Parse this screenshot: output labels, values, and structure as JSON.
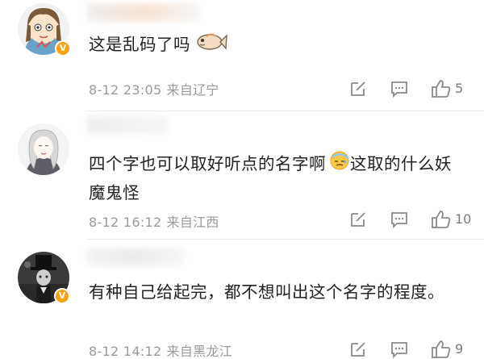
{
  "comments": [
    {
      "text": "这是乱码了吗",
      "date": "8-12 23:05",
      "location": "来自辽宁",
      "likes": "5"
    },
    {
      "text": "四个字也可以取好听点的名字啊",
      "text_after_emoji": "这取的什么妖魔鬼怪",
      "date": "8-12 16:12",
      "location": "来自江西",
      "likes": "10"
    },
    {
      "text": "有种自己给起完，都不想叫出这个名字的程度。",
      "date": "8-12 14:12",
      "location": "来自黑龙江",
      "likes": "9"
    }
  ],
  "icons": {
    "verified_badge": "verified-badge-icon",
    "fish_emoji": "fish-emoji-icon",
    "sweat_emoji": "sweat-emoji-icon",
    "edit": "edit-icon",
    "reply": "comment-icon",
    "like": "thumbs-up-icon"
  },
  "colors": {
    "meta": "#9a9a9a",
    "text": "#222222",
    "verified": "#f7a311",
    "divider": "#ececec"
  }
}
